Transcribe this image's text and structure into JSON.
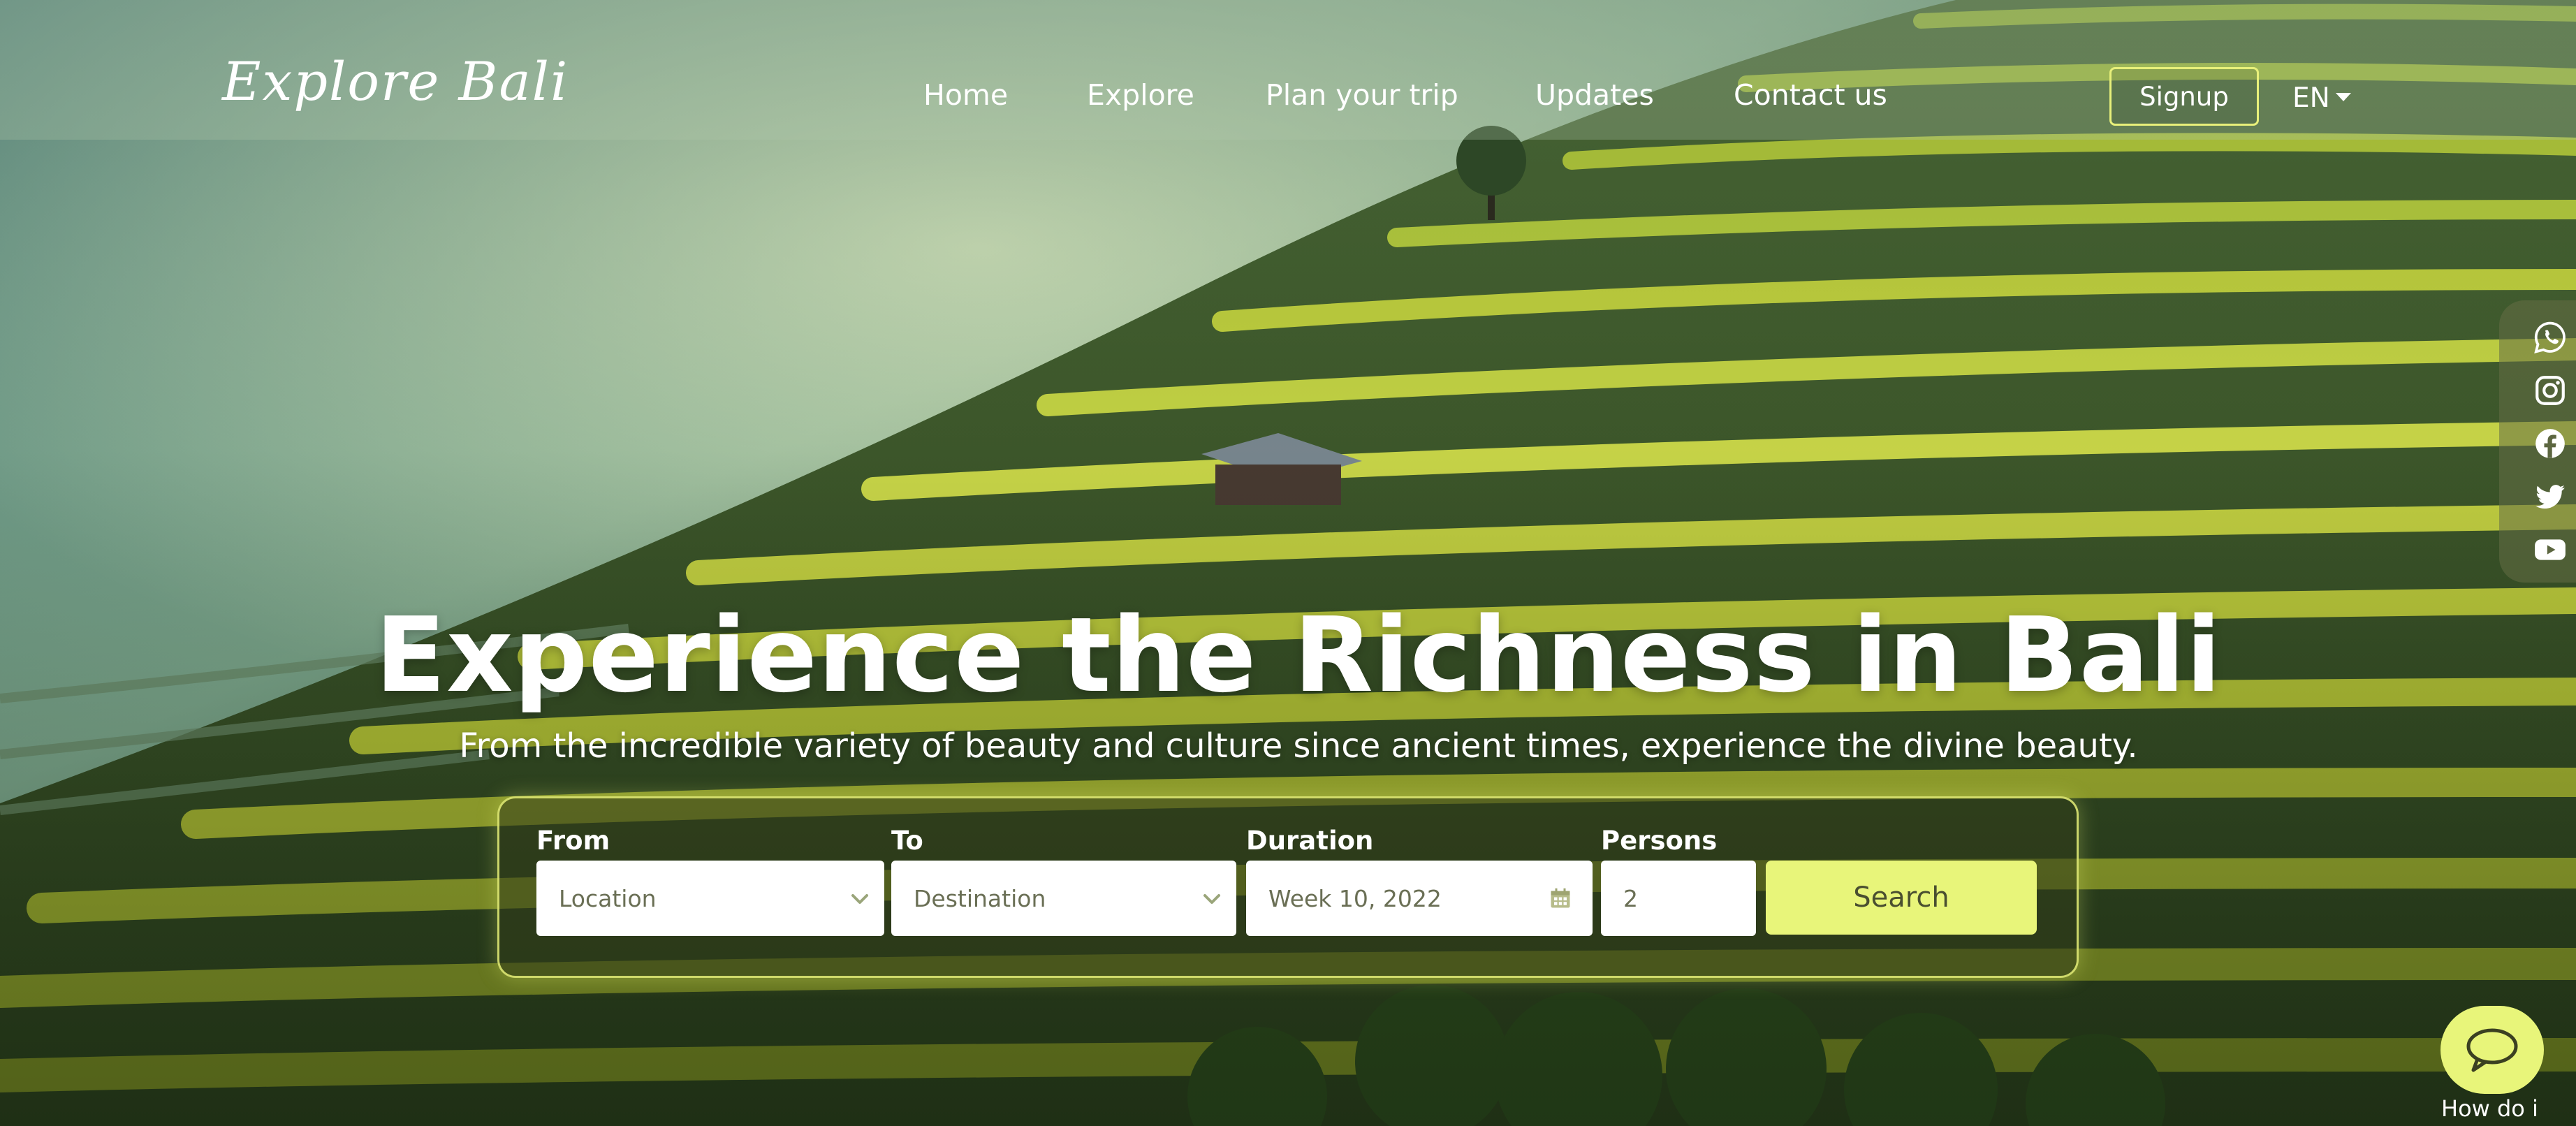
{
  "brand": {
    "logo_text": "Explore Bali"
  },
  "nav": {
    "links": [
      "Home",
      "Explore",
      "Plan your trip",
      "Updates",
      "Contact us"
    ],
    "signup_label": "Signup",
    "language": "EN"
  },
  "social": {
    "icons": [
      "whatsapp-icon",
      "instagram-icon",
      "facebook-icon",
      "twitter-icon",
      "youtube-icon"
    ]
  },
  "hero": {
    "title": "Experience the Richness in Bali",
    "subtitle": "From the incredible variety of beauty and culture since ancient times, experience the divine beauty."
  },
  "search": {
    "from_label": "From",
    "from_value": "Location",
    "to_label": "To",
    "to_value": "Destination",
    "duration_label": "Duration",
    "duration_value": "Week 10, 2022",
    "persons_label": "Persons",
    "persons_value": "2",
    "button_label": "Search"
  },
  "chat": {
    "label": "How do i"
  },
  "colors": {
    "accent": "#e8f57a",
    "navbar_overlay": "#afc8aa",
    "panel_border": "#e6f078"
  }
}
